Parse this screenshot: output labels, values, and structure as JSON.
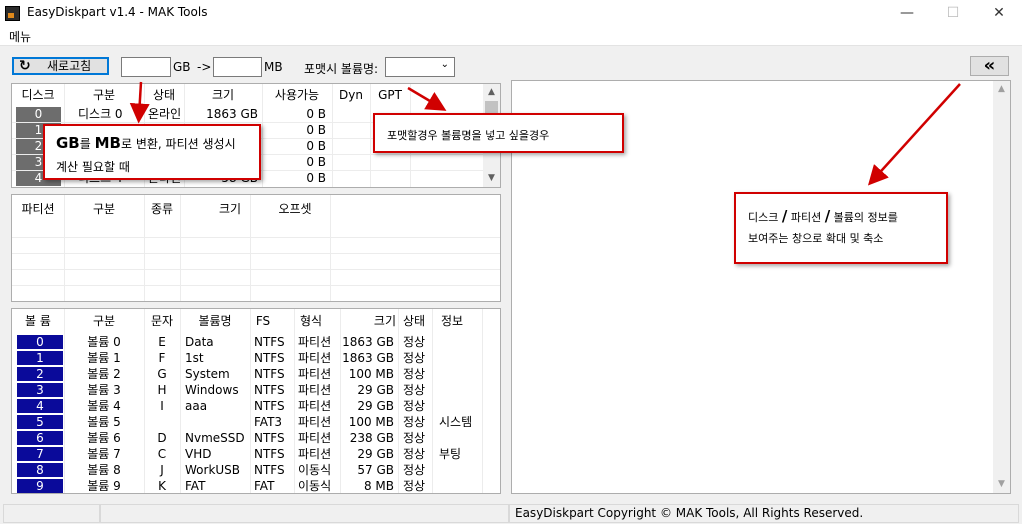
{
  "app": {
    "title": "EasyDiskpart v1.4 - MAK Tools"
  },
  "window_controls": {
    "minimize": "—",
    "maximize": "☐",
    "close": "✕"
  },
  "menu": {
    "label": "메뉴"
  },
  "toolbar": {
    "refresh_label": "새로고침",
    "gb_value": "",
    "gb_unit": "GB",
    "convert_arrow": "->",
    "mb_value": "",
    "mb_unit": "MB",
    "volume_name_label": "포맷시 볼륨명:",
    "volume_name_selected": "",
    "collapse_label": "«"
  },
  "disk_table": {
    "headers": [
      "디스크",
      "구분",
      "상태",
      "크기",
      "사용가능",
      "Dyn",
      "GPT"
    ],
    "rows": [
      {
        "index": "0",
        "name": "디스크 0",
        "status": "온라인",
        "size": "1863 GB",
        "free": "0 B"
      },
      {
        "index": "1",
        "name": "",
        "status": "",
        "size": "",
        "free": "0 B"
      },
      {
        "index": "2",
        "name": "",
        "status": "",
        "size": "",
        "free": "0 B"
      },
      {
        "index": "3",
        "name": "",
        "status": "",
        "size": "",
        "free": "0 B"
      },
      {
        "index": "4",
        "name": "디스크 4",
        "status": "온라인",
        "size": "58 GB",
        "free": "0 B"
      }
    ]
  },
  "partition_table": {
    "headers": [
      "파티션",
      "구분",
      "종류",
      "크기",
      "오프셋"
    ]
  },
  "volume_table": {
    "headers": [
      "볼 륨",
      "구분",
      "문자",
      "볼륨명",
      "FS",
      "형식",
      "크기",
      "상태",
      "정보"
    ],
    "rows": [
      {
        "index": "0",
        "name": "볼륨 0",
        "letter": "E",
        "label": "Data",
        "fs": "NTFS",
        "type": "파티션",
        "size": "1863 GB",
        "state": "정상",
        "info": ""
      },
      {
        "index": "1",
        "name": "볼륨 1",
        "letter": "F",
        "label": "1st",
        "fs": "NTFS",
        "type": "파티션",
        "size": "1863 GB",
        "state": "정상",
        "info": ""
      },
      {
        "index": "2",
        "name": "볼륨 2",
        "letter": "G",
        "label": "System",
        "fs": "NTFS",
        "type": "파티션",
        "size": "100 MB",
        "state": "정상",
        "info": ""
      },
      {
        "index": "3",
        "name": "볼륨 3",
        "letter": "H",
        "label": "Windows",
        "fs": "NTFS",
        "type": "파티션",
        "size": "29 GB",
        "state": "정상",
        "info": ""
      },
      {
        "index": "4",
        "name": "볼륨 4",
        "letter": "I",
        "label": "aaa",
        "fs": "NTFS",
        "type": "파티션",
        "size": "29 GB",
        "state": "정상",
        "info": ""
      },
      {
        "index": "5",
        "name": "볼륨 5",
        "letter": "",
        "label": "",
        "fs": "FAT3",
        "type": "파티션",
        "size": "100 MB",
        "state": "정상",
        "info": "시스템"
      },
      {
        "index": "6",
        "name": "볼륨 6",
        "letter": "D",
        "label": "NvmeSSD",
        "fs": "NTFS",
        "type": "파티션",
        "size": "238 GB",
        "state": "정상",
        "info": ""
      },
      {
        "index": "7",
        "name": "볼륨 7",
        "letter": "C",
        "label": "VHD",
        "fs": "NTFS",
        "type": "파티션",
        "size": "29 GB",
        "state": "정상",
        "info": "부팅"
      },
      {
        "index": "8",
        "name": "볼륨 8",
        "letter": "J",
        "label": "WorkUSB",
        "fs": "NTFS",
        "type": "이동식",
        "size": "57 GB",
        "state": "정상",
        "info": ""
      },
      {
        "index": "9",
        "name": "볼륨 9",
        "letter": "K",
        "label": "FAT",
        "fs": "FAT",
        "type": "이동식",
        "size": "8 MB",
        "state": "정상",
        "info": ""
      }
    ]
  },
  "annotations": {
    "gb_mb": {
      "big1": "GB",
      "small1": "를 ",
      "big2": "MB",
      "small2": "로 변환, 파티션 생성시",
      "line2": "계산 필요할 때"
    },
    "volume_name": {
      "text": "포맷할경우 볼륨명을 넣고 싶을경우"
    },
    "info_panel": {
      "line1_a": "디스크 ",
      "slash1": "/",
      "line1_b": " 파티션 ",
      "slash2": "/",
      "line1_c": " 볼륨의 정보를",
      "line2": "보여주는 창으로 확대 및 축소"
    }
  },
  "status": {
    "copyright": "EasyDiskpart Copyright © MAK Tools, All Rights Reserved."
  },
  "colors": {
    "index_gray": "#6d6d6d",
    "index_blue": "#0a0a9a",
    "annotation_red": "#d00000"
  }
}
